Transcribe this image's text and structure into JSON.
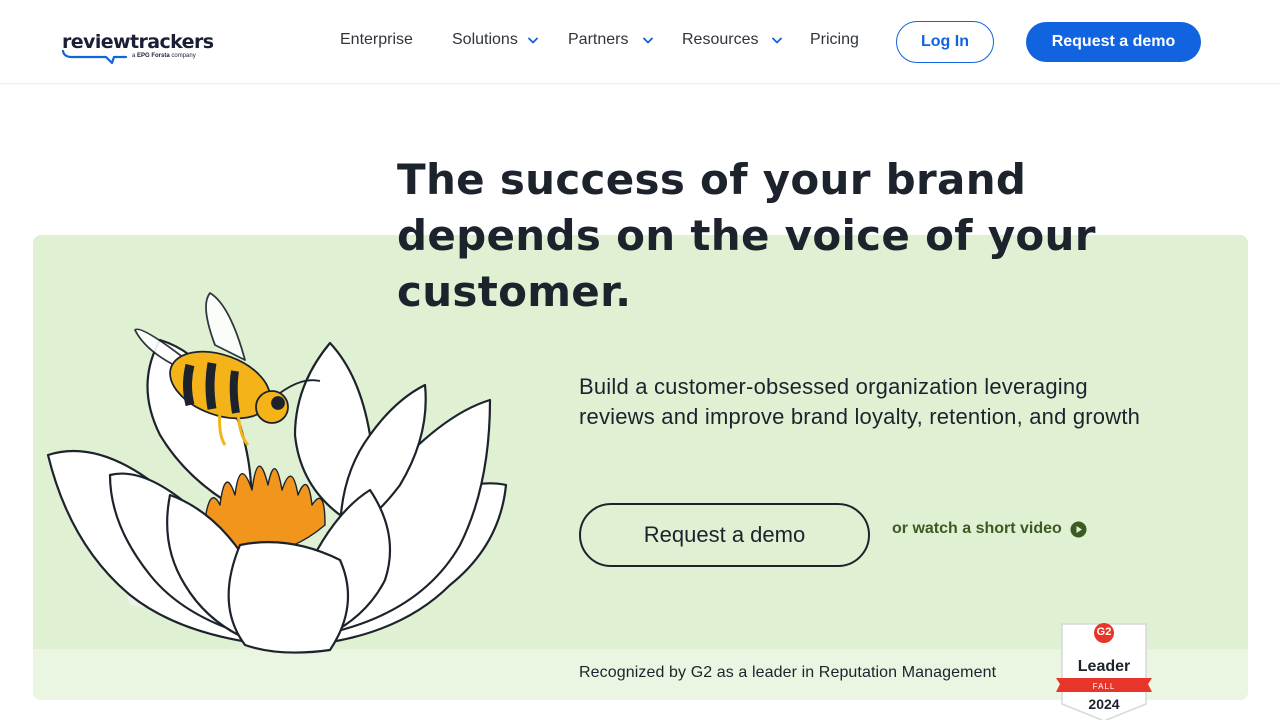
{
  "brand": {
    "name": "reviewtrackers",
    "tagline_prefix": "a",
    "tagline_parent": "EPG Forsta",
    "tagline_suffix": "company",
    "accent": "#1263e0"
  },
  "nav": {
    "items": [
      {
        "label": "Enterprise",
        "has_dropdown": false
      },
      {
        "label": "Solutions",
        "has_dropdown": true
      },
      {
        "label": "Partners",
        "has_dropdown": true
      },
      {
        "label": "Resources",
        "has_dropdown": true
      },
      {
        "label": "Pricing",
        "has_dropdown": false
      }
    ],
    "login_label": "Log In",
    "demo_label": "Request a demo"
  },
  "hero": {
    "headline": "The success of your brand depends on the voice of your customer.",
    "subhead": "Build a customer-obsessed organization leveraging reviews and improve brand loyalty, retention, and growth",
    "cta_label": "Request a demo",
    "video_link_label": "or watch a short video",
    "recognition": "Recognized by G2 as a leader in Reputation Management",
    "background": "#dff0d3"
  },
  "badge": {
    "logo": "G2",
    "title": "Leader",
    "season": "FALL",
    "year": "2024",
    "ribbon_color": "#e8352a"
  },
  "icons": [
    "chevron-down-icon",
    "play-circle-icon",
    "bee-illustration",
    "lotus-illustration"
  ]
}
